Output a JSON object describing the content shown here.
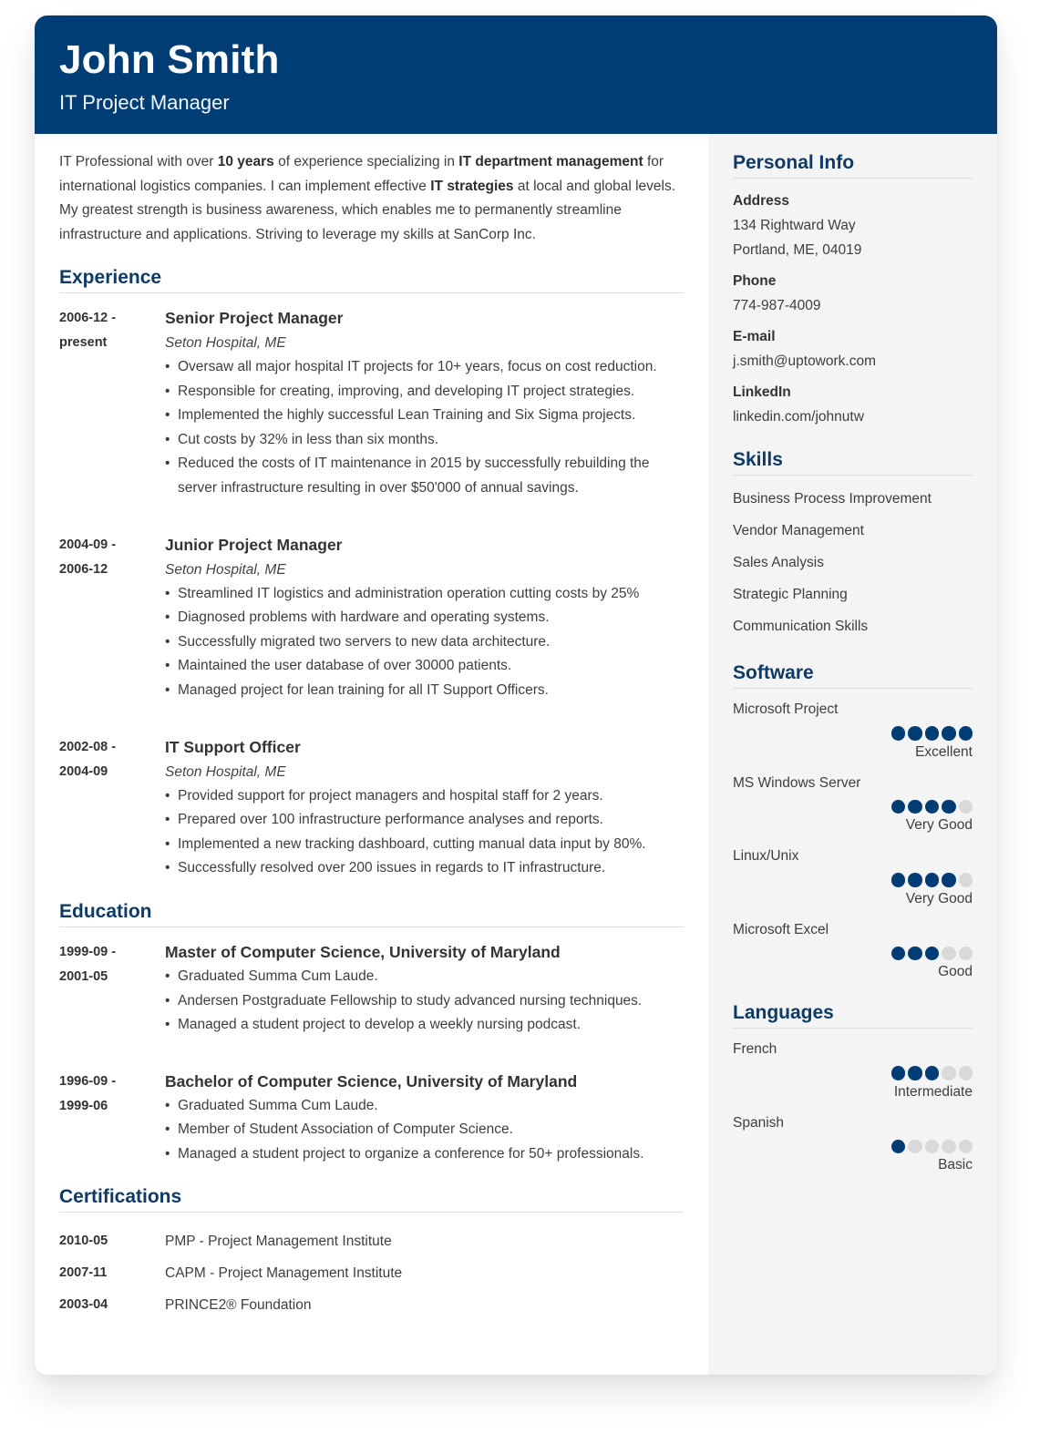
{
  "header": {
    "name": "John Smith",
    "title": "IT Project Manager"
  },
  "colors": {
    "accent": "#003d75",
    "heading": "#0d3a66",
    "sidebar_bg": "#f4f4f4",
    "dot_empty": "#d9d9d9"
  },
  "summary": {
    "parts": [
      {
        "text": "IT Professional with over ",
        "bold": false
      },
      {
        "text": "10 years",
        "bold": true
      },
      {
        "text": " of experience specializing in ",
        "bold": false
      },
      {
        "text": "IT department management",
        "bold": true
      },
      {
        "text": " for international logistics companies. I can implement effective ",
        "bold": false
      },
      {
        "text": "IT strategies",
        "bold": true
      },
      {
        "text": " at local and global levels. My greatest strength is business awareness, which enables me to permanently streamline infrastructure and applications. Striving to leverage my skills at SanCorp Inc.",
        "bold": false
      }
    ]
  },
  "experience": {
    "heading": "Experience",
    "entries": [
      {
        "date_start": "2006-12 -",
        "date_end": "present",
        "role": "Senior Project Manager",
        "company": "Seton Hospital, ME",
        "bullets": [
          "Oversaw all major hospital IT projects for 10+ years, focus on cost reduction.",
          "Responsible for creating, improving, and developing IT project strategies.",
          "Implemented the highly successful Lean Training and Six Sigma projects.",
          "Cut costs by 32% in less than six months.",
          "Reduced the costs of IT maintenance in 2015 by successfully rebuilding the server infrastructure resulting in over $50'000 of annual savings."
        ]
      },
      {
        "date_start": "2004-09 -",
        "date_end": "2006-12",
        "role": "Junior Project Manager",
        "company": "Seton Hospital, ME",
        "bullets": [
          "Streamlined IT logistics and administration operation cutting costs by 25%",
          "Diagnosed problems with hardware and operating systems.",
          "Successfully migrated two servers to new data architecture.",
          "Maintained the user database of over 30000 patients.",
          "Managed project for lean training for all IT Support Officers."
        ]
      },
      {
        "date_start": "2002-08 -",
        "date_end": "2004-09",
        "role": "IT Support Officer",
        "company": "Seton Hospital, ME",
        "bullets": [
          "Provided support for project managers and hospital staff for 2 years.",
          "Prepared over 100 infrastructure performance analyses and reports.",
          "Implemented a new tracking dashboard, cutting manual data input by 80%.",
          "Successfully resolved over 200 issues in regards to IT infrastructure."
        ]
      }
    ]
  },
  "education": {
    "heading": "Education",
    "entries": [
      {
        "date_start": "1999-09 -",
        "date_end": "2001-05",
        "degree": "Master of Computer Science, University of Maryland",
        "bullets": [
          "Graduated Summa Cum Laude.",
          "Andersen Postgraduate Fellowship to study advanced nursing techniques.",
          "Managed a student project to develop a weekly nursing podcast."
        ]
      },
      {
        "date_start": "1996-09 -",
        "date_end": "1999-06",
        "degree": "Bachelor of Computer Science, University of Maryland",
        "bullets": [
          "Graduated Summa Cum Laude.",
          "Member of Student Association of Computer Science.",
          "Managed a student project to organize a conference for 50+ professionals."
        ]
      }
    ]
  },
  "certifications": {
    "heading": "Certifications",
    "items": [
      {
        "date": "2010-05",
        "label": "PMP - Project Management Institute"
      },
      {
        "date": "2007-11",
        "label": "CAPM - Project Management Institute"
      },
      {
        "date": "2003-04",
        "label": "PRINCE2® Foundation"
      }
    ]
  },
  "personal_info": {
    "heading": "Personal Info",
    "address_label": "Address",
    "address_line1": "134 Rightward Way",
    "address_line2": "Portland, ME, 04019",
    "phone_label": "Phone",
    "phone": "774-987-4009",
    "email_label": "E-mail",
    "email": "j.smith@uptowork.com",
    "linkedin_label": "LinkedIn",
    "linkedin": "linkedin.com/johnutw"
  },
  "skills": {
    "heading": "Skills",
    "items": [
      "Business Process Improvement",
      "Vendor Management",
      "Sales Analysis",
      "Strategic Planning",
      "Communication Skills"
    ]
  },
  "software": {
    "heading": "Software",
    "max_rating": 5,
    "items": [
      {
        "name": "Microsoft Project",
        "rating": 5,
        "level": "Excellent"
      },
      {
        "name": "MS Windows Server",
        "rating": 4,
        "level": "Very Good"
      },
      {
        "name": "Linux/Unix",
        "rating": 4,
        "level": "Very Good"
      },
      {
        "name": "Microsoft Excel",
        "rating": 3,
        "level": "Good"
      }
    ]
  },
  "languages": {
    "heading": "Languages",
    "max_rating": 5,
    "items": [
      {
        "name": "French",
        "rating": 3,
        "level": "Intermediate"
      },
      {
        "name": "Spanish",
        "rating": 1,
        "level": "Basic"
      }
    ]
  }
}
